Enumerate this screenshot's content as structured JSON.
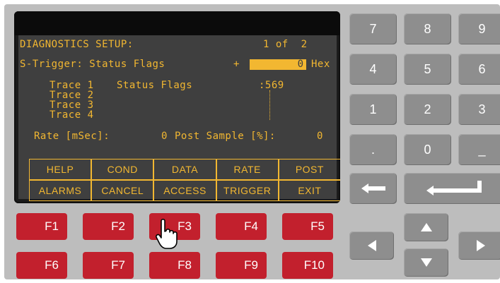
{
  "screen": {
    "title": "DIAGNOSTICS SETUP:",
    "page": "1 of  2",
    "trigger_label": "S-Trigger: Status Flags",
    "trigger_sign": "+",
    "trigger_value": "0",
    "trigger_unit": "Hex",
    "traces": [
      {
        "label": "Trace 1",
        "desc": "Status Flags",
        "value": ":569"
      },
      {
        "label": "Trace 2",
        "desc": "",
        "value": ""
      },
      {
        "label": "Trace 3",
        "desc": "",
        "value": ""
      },
      {
        "label": "Trace 4",
        "desc": "",
        "value": ""
      }
    ],
    "rate_label": "Rate [mSec]:",
    "rate_value": "0",
    "post_label": "Post Sample [%]:",
    "post_value": "0"
  },
  "softkeys": {
    "row1": [
      "HELP",
      "COND",
      "DATA",
      "RATE",
      "POST"
    ],
    "row2": [
      "ALARMS",
      "CANCEL",
      "ACCESS",
      "TRIGGER",
      "EXIT"
    ]
  },
  "keypad": {
    "digits": [
      "7",
      "8",
      "9",
      "4",
      "5",
      "6",
      "1",
      "2",
      "3",
      ".",
      "0",
      "_"
    ]
  },
  "function_keys": [
    "F1",
    "F2",
    "F3",
    "F4",
    "F5",
    "F6",
    "F7",
    "F8",
    "F9",
    "F10"
  ],
  "colors": {
    "lcd_text": "#f2b731",
    "lcd_background": "#3f3f3f",
    "function_key": "#c2202d",
    "keypad_key": "#8e8e8e",
    "panel": "#bdbdbd"
  },
  "icons": {
    "backspace": "left-arrow-icon",
    "enter": "enter-arrow-icon",
    "up": "arrow-up-icon",
    "down": "arrow-down-icon",
    "left": "arrow-left-icon",
    "right": "arrow-right-icon",
    "cursor": "hand-pointer-icon"
  }
}
